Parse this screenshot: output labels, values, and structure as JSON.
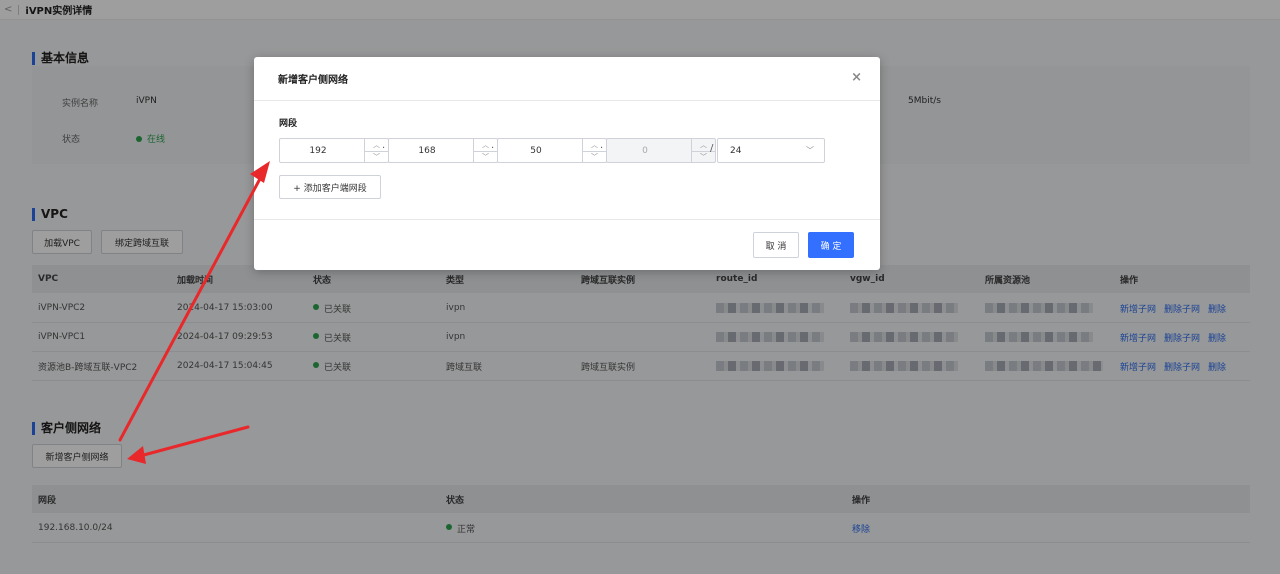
{
  "page": {
    "title": "iVPN实例详情",
    "back_glyph": "<"
  },
  "basic": {
    "section_title": "基本信息",
    "name_label": "实例名称",
    "name_value": "iVPN",
    "status_label": "状态",
    "status_value": "在线",
    "bandwidth_value": "5Mbit/s"
  },
  "vpc": {
    "section_title": "VPC",
    "load_vpc_label": "加载VPC",
    "bind_label": "绑定跨域互联",
    "columns": [
      "VPC",
      "加载时间",
      "状态",
      "类型",
      "跨域互联实例",
      "route_id",
      "vgw_id",
      "所属资源池",
      "操作"
    ],
    "rows": [
      {
        "vpc": "iVPN-VPC2",
        "time": "2024-04-17 15:03:00",
        "status": "已关联",
        "type": "ivpn",
        "cross": ""
      },
      {
        "vpc": "iVPN-VPC1",
        "time": "2024-04-17 09:29:53",
        "status": "已关联",
        "type": "ivpn",
        "cross": ""
      },
      {
        "vpc": "资源池B-跨域互联-VPC2",
        "time": "2024-04-17 15:04:45",
        "status": "已关联",
        "type": "跨域互联",
        "cross": "跨域互联实例"
      }
    ],
    "actions": {
      "add_subnet": "新增子网",
      "delete_subnet": "删除子网",
      "delete": "删除"
    }
  },
  "client": {
    "section_title": "客户侧网络",
    "add_button": "新增客户侧网络",
    "columns": [
      "网段",
      "状态",
      "操作"
    ],
    "rows": [
      {
        "segment": "192.168.10.0/24",
        "status": "正常",
        "action": "移除"
      }
    ]
  },
  "modal": {
    "title": "新增客户侧网络",
    "close_glyph": "×",
    "field_label": "网段",
    "octets": [
      "192",
      "168",
      "50",
      "0"
    ],
    "dot": "·",
    "slash": "/",
    "mask": "24",
    "add_segment": "+ 添加客户端网段",
    "cancel": "取 消",
    "confirm": "确 定"
  },
  "colors": {
    "accent": "#3370ff",
    "success": "#2ea44f",
    "annotation": "#e8282b"
  }
}
